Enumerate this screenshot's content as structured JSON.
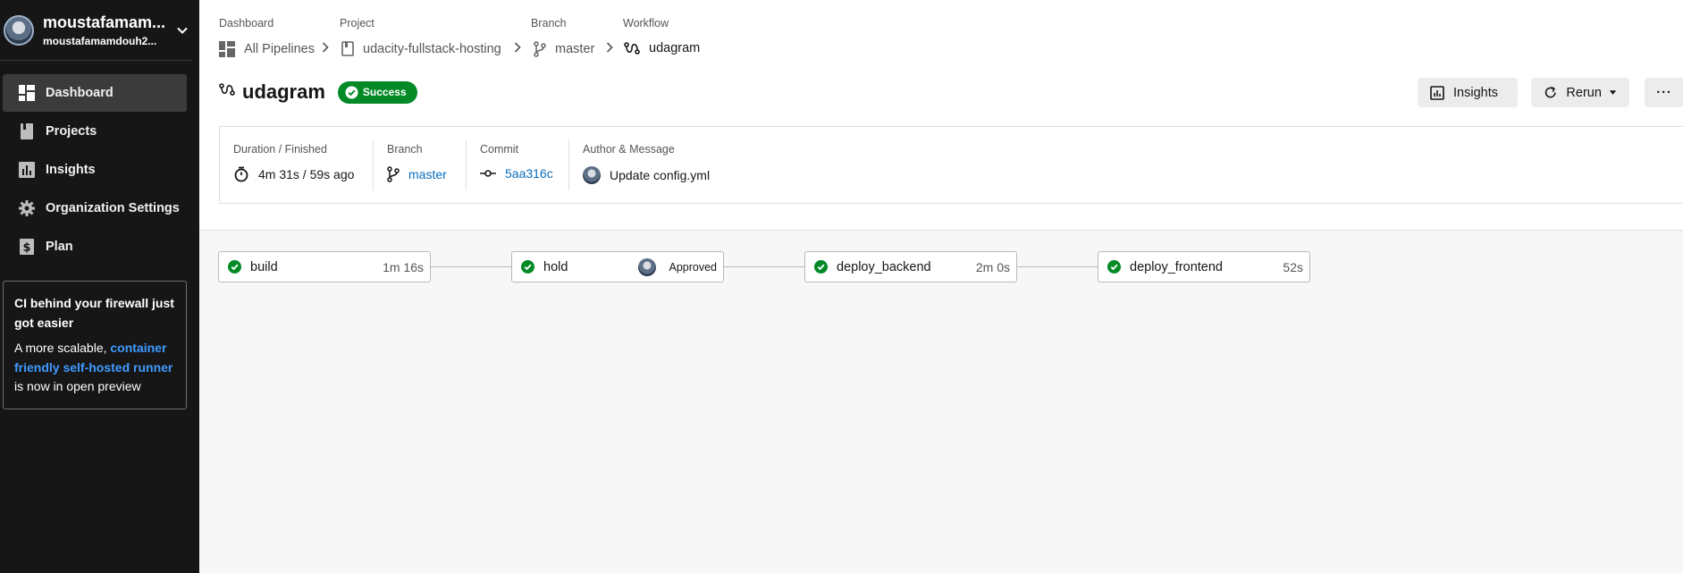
{
  "user": {
    "name": "moustafamam...",
    "email": "moustafamamdouh2..."
  },
  "nav": [
    {
      "label": "Dashboard",
      "icon": "dashboard-icon"
    },
    {
      "label": "Projects",
      "icon": "book-icon"
    },
    {
      "label": "Insights",
      "icon": "chart-icon"
    },
    {
      "label": "Organization Settings",
      "icon": "gear-icon"
    },
    {
      "label": "Plan",
      "icon": "dollar-icon"
    }
  ],
  "promo": {
    "title": "CI behind your firewall just got easier",
    "text_before": "A more scalable,",
    "link": "container friendly self-hosted runner",
    "text_after": "is now in open preview"
  },
  "breadcrumb": {
    "labels": [
      "Dashboard",
      "Project",
      "Branch",
      "Workflow"
    ],
    "items": [
      "All Pipelines",
      "udacity-fullstack-hosting",
      "master",
      "udagram"
    ]
  },
  "workflow": {
    "title": "udagram",
    "status": "Success"
  },
  "actions": {
    "insights": "Insights",
    "rerun": "Rerun",
    "more": "···"
  },
  "summary": {
    "duration_label": "Duration / Finished",
    "duration_value": "4m 31s / 59s ago",
    "branch_label": "Branch",
    "branch_value": "master",
    "commit_label": "Commit",
    "commit_value": "5aa316c",
    "author_label": "Author & Message",
    "message": "Update config.yml"
  },
  "jobs": [
    {
      "name": "build",
      "duration": "1m 16s"
    },
    {
      "name": "hold",
      "approval": "Approved"
    },
    {
      "name": "deploy_backend",
      "duration": "2m 0s"
    },
    {
      "name": "deploy_frontend",
      "duration": "52s"
    }
  ],
  "colors": {
    "sidebar": "#161616",
    "success": "#038a26",
    "link": "#0a6ebd",
    "promo_link": "#3e9bff"
  }
}
